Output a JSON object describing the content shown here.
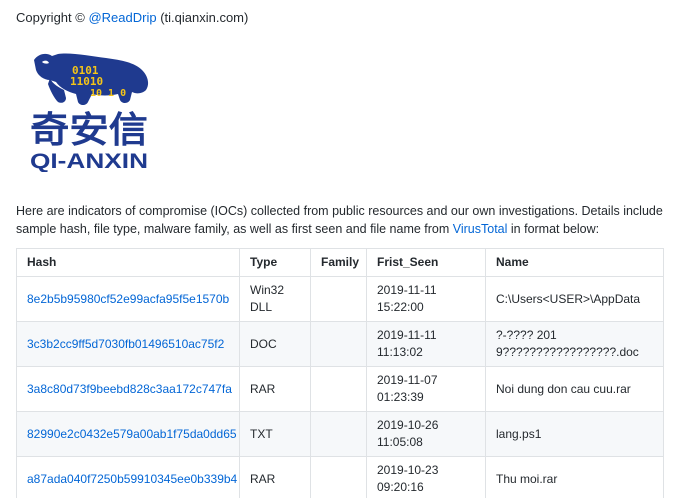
{
  "copyright": {
    "prefix": "Copyright © ",
    "author_link": "@ReadDrip",
    "suffix": " (ti.qianxin.com)"
  },
  "logo": {
    "chinese": "奇安信",
    "english": "QI-ANXIN",
    "binary_rows": [
      "0101",
      "11010",
      "10 1 0"
    ],
    "colors": {
      "blue": "#1f3a8f",
      "yellow": "#f5c518"
    }
  },
  "intro": {
    "text_before": "Here are indicators of compromise (IOCs) collected from public resources and our own investigations. Details include sample hash, file type, malware family, as well as first seen and file name from ",
    "link": "VirusTotal",
    "text_after": " in format below:"
  },
  "table": {
    "headers": [
      "Hash",
      "Type",
      "Family",
      "Frist_Seen",
      "Name"
    ],
    "rows": [
      {
        "hash": "8e2b5b95980cf52e99acfa95f5e1570b",
        "type": "Win32 DLL",
        "family": "",
        "first_seen": "2019-11-11 15:22:00",
        "name": "C:\\Users<USER>\\AppData"
      },
      {
        "hash": "3c3b2cc9ff5d7030fb01496510ac75f2",
        "type": "DOC",
        "family": "",
        "first_seen": "2019-11-11 11:13:02",
        "name": "?-???? 2019?????????????????.doc"
      },
      {
        "hash": "3a8c80d73f9beebd828c3aa172c747fa",
        "type": "RAR",
        "family": "",
        "first_seen": "2019-11-07 01:23:39",
        "name": "Noi dung don cau cuu.rar"
      },
      {
        "hash": "82990e2c0432e579a00ab1f75da0dd65",
        "type": "TXT",
        "family": "",
        "first_seen": "2019-10-26 11:05:08",
        "name": "lang.ps1"
      },
      {
        "hash": "a87ada040f7250b59910345ee0b339b4",
        "type": "RAR",
        "family": "",
        "first_seen": "2019-10-23 09:20:16",
        "name": "Thu moi.rar"
      }
    ]
  }
}
